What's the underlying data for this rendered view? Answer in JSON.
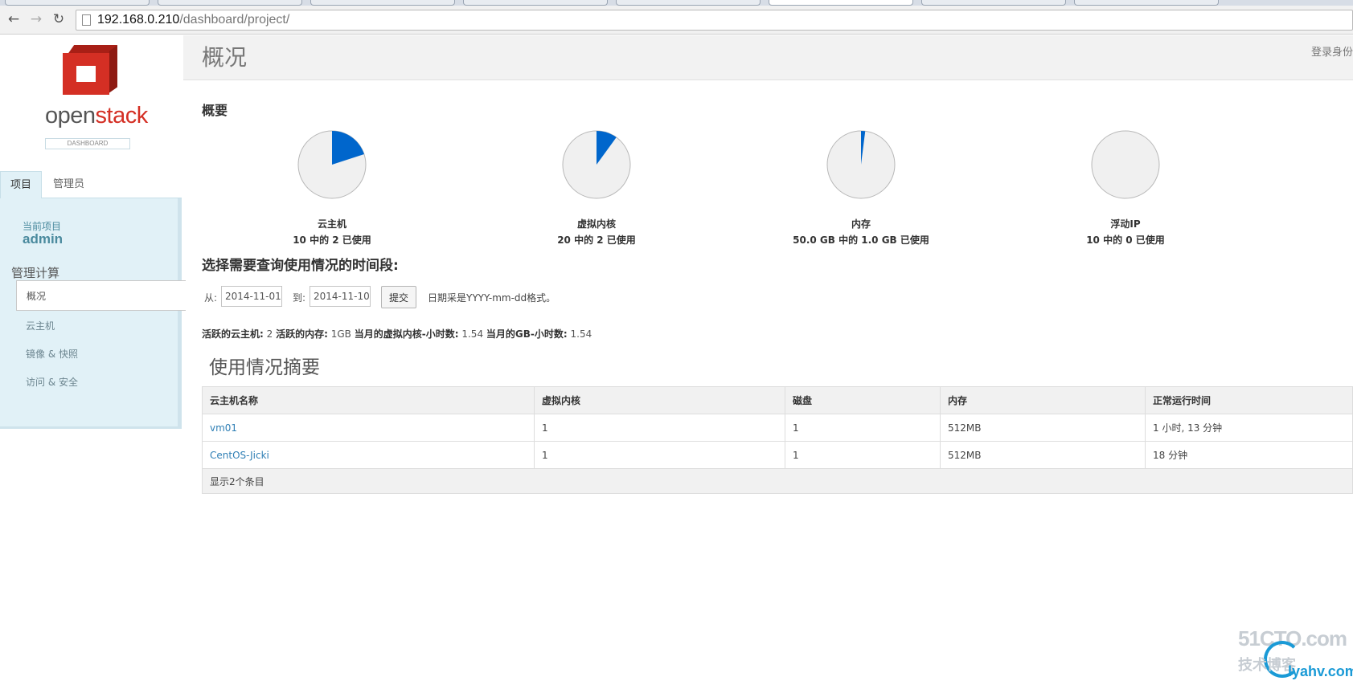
{
  "browser": {
    "url_host": "192.168.0.210",
    "url_path": "/dashboard/project/"
  },
  "logo": {
    "word_a": "open",
    "word_b": "stack",
    "tagline": "DASHBOARD"
  },
  "sidebar": {
    "tabs": [
      "项目",
      "管理员"
    ],
    "current_project_label": "当前项目",
    "current_project": "admin",
    "section_title": "管理计算",
    "items": [
      "概况",
      "云主机",
      "镜像 & 快照",
      "访问 & 安全"
    ]
  },
  "header": {
    "title": "概况",
    "login_text": "登录身份"
  },
  "overview": {
    "heading": "概要",
    "quotas": [
      {
        "title": "云主机",
        "subtitle": "10 中的 2 已使用",
        "used": 2,
        "total": 10
      },
      {
        "title": "虚拟内核",
        "subtitle": "20 中的 2 已使用",
        "used": 2,
        "total": 20
      },
      {
        "title": "内存",
        "subtitle": "50.0 GB 中的 1.0 GB 已使用",
        "used": 1.0,
        "total": 50.0
      },
      {
        "title": "浮动IP",
        "subtitle": "10 中的 0 已使用",
        "used": 0,
        "total": 10
      }
    ],
    "pie_used_color": "#0066cc",
    "pie_free_color": "#f0f0f0"
  },
  "date_filter": {
    "heading": "选择需要查询使用情况的时间段:",
    "from_label": "从:",
    "from_value": "2014-11-01",
    "to_label": "到:",
    "to_value": "2014-11-10",
    "submit_label": "提交",
    "hint": "日期采是YYYY-mm-dd格式。"
  },
  "summary": {
    "active_instances_label": "活跃的云主机:",
    "active_instances": "2",
    "active_memory_label": "活跃的内存:",
    "active_memory": "1GB",
    "vcpu_hours_label": "当月的虚拟内核-小时数:",
    "vcpu_hours": "1.54",
    "gb_hours_label": "当月的GB-小时数:",
    "gb_hours": "1.54"
  },
  "usage": {
    "heading": "使用情况摘要",
    "columns": [
      "云主机名称",
      "虚拟内核",
      "磁盘",
      "内存",
      "正常运行时间"
    ],
    "rows": [
      [
        "vm01",
        "1",
        "1",
        "512MB",
        "1 小时, 13 分钟"
      ],
      [
        "CentOS-Jicki",
        "1",
        "1",
        "512MB",
        "18 分钟"
      ]
    ],
    "footer": "显示2个条目"
  },
  "watermark": {
    "top": "51CTO.com",
    "sub": "技术博客",
    "site": "lyahv.com"
  }
}
